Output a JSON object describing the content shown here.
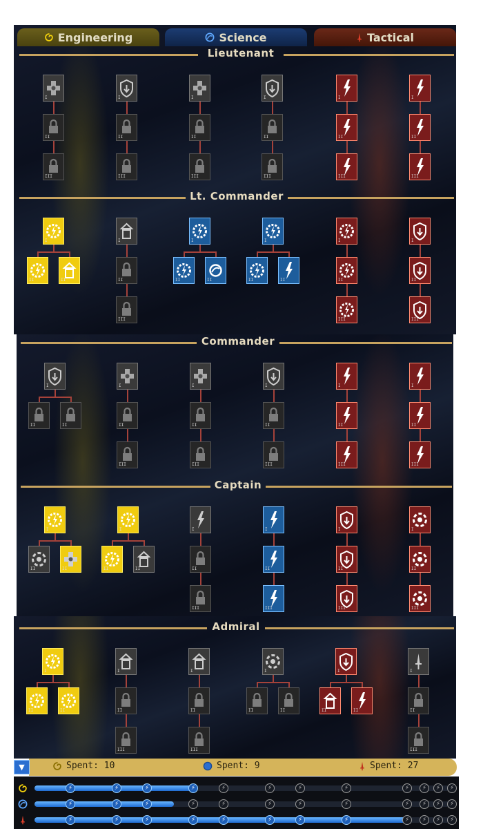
{
  "tabs": [
    {
      "label": "Engineering",
      "icon": "engineering-swirl-icon",
      "color": "#e8c800"
    },
    {
      "label": "Science",
      "icon": "science-orb-icon",
      "color": "#3b8cff"
    },
    {
      "label": "Tactical",
      "icon": "tactical-dagger-icon",
      "color": "#e0402a"
    }
  ],
  "tiers": [
    {
      "title": "Lieutenant"
    },
    {
      "title": "Lt. Commander"
    },
    {
      "title": "Commander"
    },
    {
      "title": "Captain"
    },
    {
      "title": "Admiral"
    }
  ],
  "spent": {
    "engineering": "Spent: 10",
    "science": "Spent: 9",
    "tactical": "Spent: 27"
  },
  "progress": {
    "engineering": 0.38,
    "science": 0.33,
    "tactical": 0.88
  },
  "colors": {
    "gold_line": "#c7a35f",
    "engineering": "#f0cc10",
    "science": "#1d5d9c",
    "tactical": "#7a1c1c",
    "connector": "#a5423a",
    "progress_fill": "#2d86e8"
  },
  "rank_labels": {
    "rank1": "I",
    "rank2": "II",
    "rank3": "III"
  }
}
